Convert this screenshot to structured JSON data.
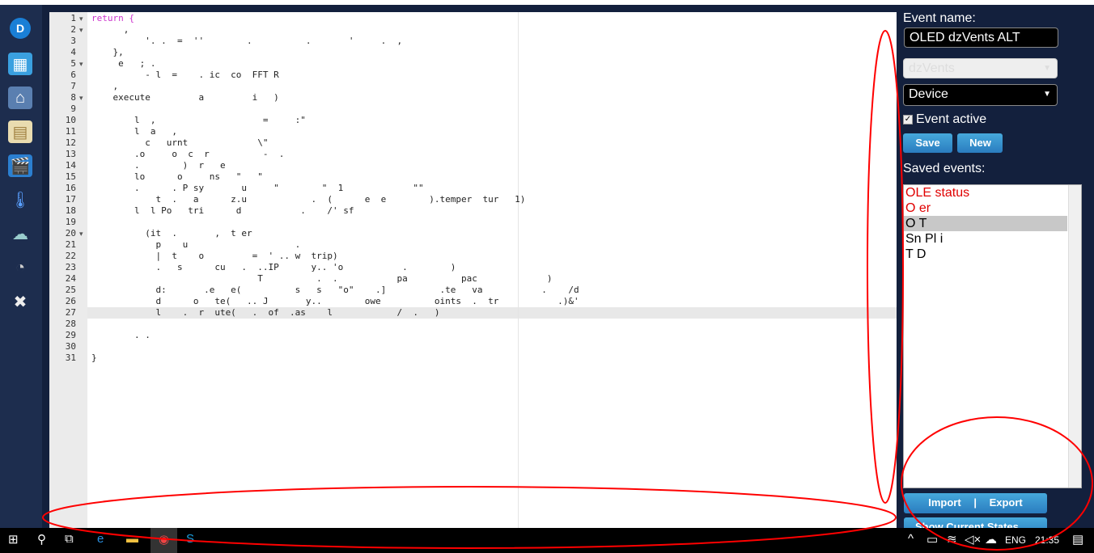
{
  "sidebar": {
    "items": [
      "domoticz-logo",
      "dashboard",
      "floorplans",
      "switches",
      "scenes",
      "temperature",
      "weather",
      "utility",
      "setup"
    ]
  },
  "editor": {
    "lines": [
      {
        "n": "1",
        "text": "return {",
        "fold": true
      },
      {
        "n": "2",
        "text": "      ,",
        "fold": true
      },
      {
        "n": "3",
        "text": "          '. .  =  ''        .          .       '     .  ,",
        "fold": false
      },
      {
        "n": "4",
        "text": "    },",
        "fold": false
      },
      {
        "n": "5",
        "text": "     e   ; .",
        "fold": true
      },
      {
        "n": "6",
        "text": "          - l  =    . ic  co  FFT R",
        "fold": false
      },
      {
        "n": "7",
        "text": "    ,",
        "fold": false
      },
      {
        "n": "8",
        "text": "    execute         a         i   )",
        "fold": true
      },
      {
        "n": "9",
        "text": "",
        "fold": false
      },
      {
        "n": "10",
        "text": "        l  ,                    =     :\"",
        "fold": false
      },
      {
        "n": "11",
        "text": "        l  a   ,",
        "fold": false
      },
      {
        "n": "12",
        "text": "          c   urnt             \\\"",
        "fold": false
      },
      {
        "n": "13",
        "text": "        .o     o  c  r          -  .",
        "fold": false
      },
      {
        "n": "14",
        "text": "        .        )  r   e",
        "fold": false
      },
      {
        "n": "15",
        "text": "        lo      o     ns   \"   \"",
        "fold": false
      },
      {
        "n": "16",
        "text": "        .      . P sy       u     \"        \"  1             \"\"",
        "fold": false
      },
      {
        "n": "17",
        "text": "            t  .   a      z.u            .  (      e  e        ).temper  tur   1)",
        "fold": false
      },
      {
        "n": "18",
        "text": "        l  l Po   tri      d           .    /' sf",
        "fold": false
      },
      {
        "n": "19",
        "text": "",
        "fold": false
      },
      {
        "n": "20",
        "text": "          (it  .       ,  t er",
        "fold": true
      },
      {
        "n": "21",
        "text": "            p    u                    .",
        "fold": false
      },
      {
        "n": "22",
        "text": "            |  t    o         =  ' .. w  trip)",
        "fold": false
      },
      {
        "n": "23",
        "text": "            .   s      cu   .  ..IP      y.. 'o           .        )",
        "fold": false
      },
      {
        "n": "24",
        "text": "                               T          .  .           pa          pac             )",
        "fold": false
      },
      {
        "n": "25",
        "text": "            d:       .e   e(          s   s   \"o\"    .]          .te   va           .    /d",
        "fold": false
      },
      {
        "n": "26",
        "text": "            d      o   te(   .. J       y..        owe          oints  .  tr           .)&'",
        "fold": false
      },
      {
        "n": "27",
        "text": "            l    .  r  ute(   .  of  .as    l            /  .   )",
        "fold": false
      },
      {
        "n": "28",
        "text": "",
        "fold": false
      },
      {
        "n": "29",
        "text": "        . .",
        "fold": false
      },
      {
        "n": "30",
        "text": "",
        "fold": false
      },
      {
        "n": "31",
        "text": "}",
        "fold": false
      }
    ]
  },
  "panel": {
    "event_name_label": "Event name:",
    "event_name_value": "OLED dzVents ALT",
    "language_select": "dzVents",
    "trigger_select": "Device",
    "event_active_label": "Event active",
    "event_active": true,
    "save_label": "Save",
    "new_label": "New",
    "saved_events_label": "Saved events:",
    "saved_events": [
      {
        "name": "OLE         status",
        "color": "#e00000",
        "selected": false
      },
      {
        "name": "O           er",
        "color": "#e00000",
        "selected": false
      },
      {
        "name": "O            T",
        "color": "#000000",
        "selected": true
      },
      {
        "name": "Sn   Pl        i",
        "color": "#000000",
        "selected": false
      },
      {
        "name": "T   D",
        "color": "#000000",
        "selected": false
      }
    ],
    "import_label": "Import",
    "export_label": "Export",
    "show_states_label": "Show Current States"
  },
  "taskbar": {
    "language": "ENG",
    "time": "21:35"
  },
  "colors": {
    "background": "#13203d",
    "button": "#3595d0",
    "annotation": "#ff0000"
  }
}
